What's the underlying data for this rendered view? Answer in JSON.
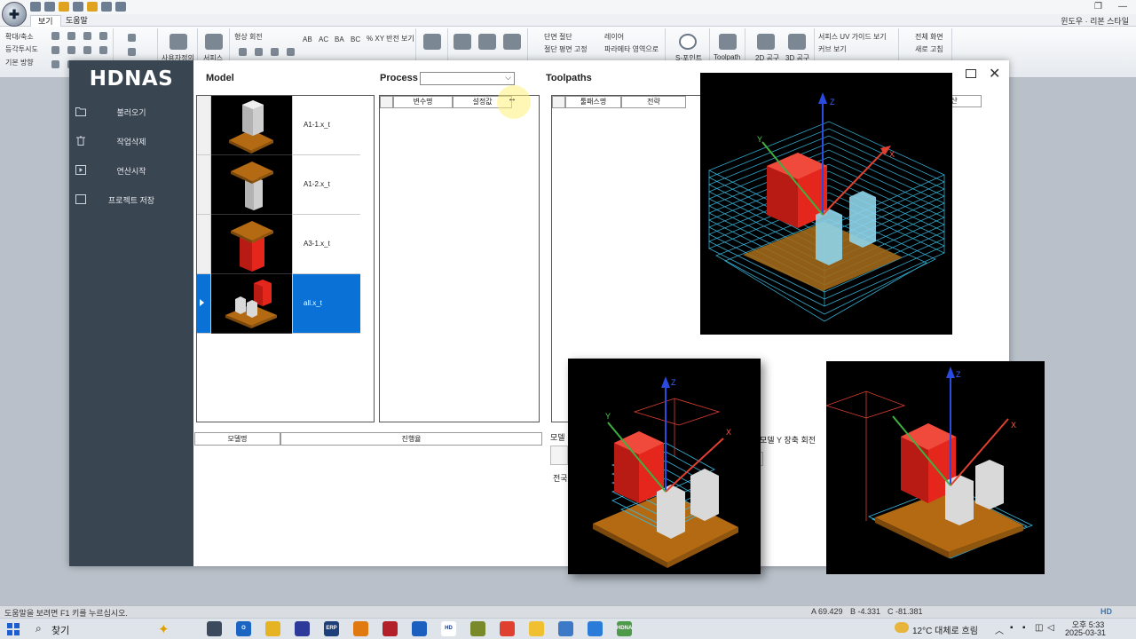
{
  "host_app": {
    "tabs": [
      "보기",
      "도움말"
    ],
    "ribbon_right": [
      "윈도우",
      "리본 스타일"
    ],
    "ribbon_labels": {
      "zoom": "확대/축소",
      "iso": "등각투시도",
      "basic_dir": "기본 방향",
      "user_def": "사용자정의",
      "service": "서피스",
      "shape_rotate": "형상 회전",
      "flip": "XY 반전 보기",
      "section": "단면 절단",
      "cut_plane": "절단 평면 고정",
      "layer": "레이어",
      "param_area": "파라메타 영역으로",
      "s_point": "S-포인트",
      "toolpath": "Toolpath",
      "tool2d": "2D 공구",
      "tool3d": "3D 공구",
      "surface_uv": "서피스 UV 가이드 보기",
      "curve_view": "커브 보기",
      "full_screen": "전체 화면",
      "refresh": "새로 고침",
      "axes_ac": "AC",
      "axes_ab": "AB",
      "axes_ba": "BA",
      "axes_bc": "BC",
      "percent": "%"
    }
  },
  "dialog": {
    "brand": "HDNAS",
    "menu": [
      {
        "label": "불러오기",
        "icon": "folder-icon"
      },
      {
        "label": "작업삭제",
        "icon": "trash-icon"
      },
      {
        "label": "연산시작",
        "icon": "play-icon"
      },
      {
        "label": "프로젝트 저장",
        "icon": "checkbox-icon"
      }
    ],
    "model_title": "Model",
    "process_title": "Process",
    "process_value": "",
    "toolpaths_title": "Toolpaths",
    "models": [
      {
        "name": "A1-1.x_t",
        "selected": false
      },
      {
        "name": "A1-2.x_t",
        "selected": false
      },
      {
        "name": "A3-1.x_t",
        "selected": false
      },
      {
        "name": "all.x_t",
        "selected": true
      }
    ],
    "param_columns": [
      "변수명",
      "설정값"
    ],
    "toolpath_columns": [
      "툴패스명",
      "전략"
    ],
    "toolpath_last_column": "산",
    "progress_columns": [
      "모델명",
      "진행율"
    ],
    "fragments": {
      "model_label": "모델",
      "rotate_y": "모델 Y 장축 회전",
      "jeonguk": "전국"
    }
  },
  "status": {
    "message": "도움말을 보려면 F1 키를 누르십시오.",
    "a": "A 69.429",
    "b": "B -4.331",
    "c": "C -81.381"
  },
  "taskbar": {
    "search_label": "찾기",
    "apps": [
      {
        "name": "task-view",
        "color": "#3b4a5c",
        "label": ""
      },
      {
        "name": "outlook",
        "color": "#1a64c2",
        "label": "O"
      },
      {
        "name": "files",
        "color": "#e6b422",
        "label": ""
      },
      {
        "name": "media",
        "color": "#2e3a9a",
        "label": ""
      },
      {
        "name": "erp",
        "color": "#1d3f7a",
        "label": "ERP"
      },
      {
        "name": "search-app",
        "color": "#e07a10",
        "label": ""
      },
      {
        "name": "viewer",
        "color": "#b3202a",
        "label": ""
      },
      {
        "name": "folder-app",
        "color": "#1b5fbf",
        "label": ""
      },
      {
        "name": "hd-app",
        "color": "#ffffff",
        "label": "HD"
      },
      {
        "name": "cad-app",
        "color": "#7a8a2a",
        "label": ""
      },
      {
        "name": "chrome",
        "color": "#e04030",
        "label": ""
      },
      {
        "name": "explorer",
        "color": "#f0c030",
        "label": ""
      },
      {
        "name": "network",
        "color": "#3c7ac8",
        "label": ""
      },
      {
        "name": "edge",
        "color": "#2b7bd8",
        "label": ""
      },
      {
        "name": "hdnas-app",
        "color": "#4d9b4a",
        "label": "HDNAS"
      }
    ],
    "weather": "12°C 대체로 흐림",
    "time": "오후 5:33",
    "date": "2025-03-31",
    "watermark": "HD"
  },
  "colors": {
    "sidebar": "#3a4552",
    "selection": "#0a72d6",
    "part_red": "#e5261d",
    "part_gray": "#d9d9d9",
    "plate": "#b36a12",
    "path_cyan": "#38b8e0"
  },
  "viewports": {
    "axis_labels": {
      "x": "X",
      "y": "Y",
      "z": "Z"
    }
  }
}
